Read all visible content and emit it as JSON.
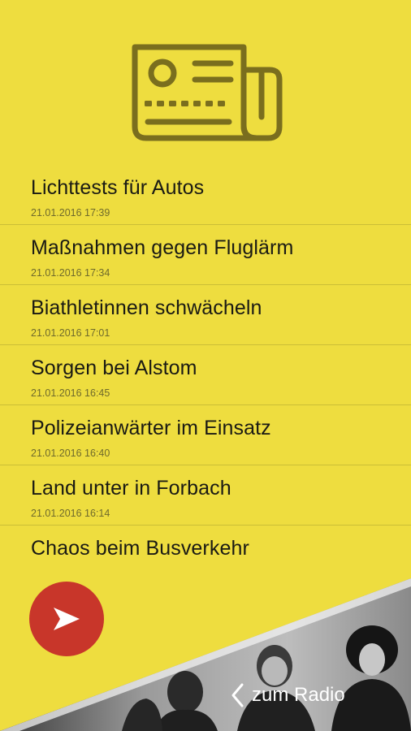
{
  "news": {
    "items": [
      {
        "title": "Lichttests für Autos",
        "date": "21.01.2016 17:39"
      },
      {
        "title": "Maßnahmen gegen Fluglärm",
        "date": "21.01.2016 17:34"
      },
      {
        "title": "Biathletinnen schwächeln",
        "date": "21.01.2016 17:01"
      },
      {
        "title": "Sorgen bei Alstom",
        "date": "21.01.2016 16:45"
      },
      {
        "title": "Polizeianwärter im Einsatz",
        "date": "21.01.2016 16:40"
      },
      {
        "title": "Land unter in Forbach",
        "date": "21.01.2016 16:14"
      },
      {
        "title": "Chaos beim Busverkehr",
        "date": ""
      }
    ]
  },
  "radio": {
    "link_label": "zum Radio"
  },
  "icons": {
    "header": "newspaper-icon",
    "play": "play-icon",
    "back": "chevron-left-icon"
  },
  "colors": {
    "background": "#EEDD3F",
    "icon_stroke": "#7A6E1E",
    "play_button": "#C8362A",
    "divider": "#CBBE36"
  }
}
